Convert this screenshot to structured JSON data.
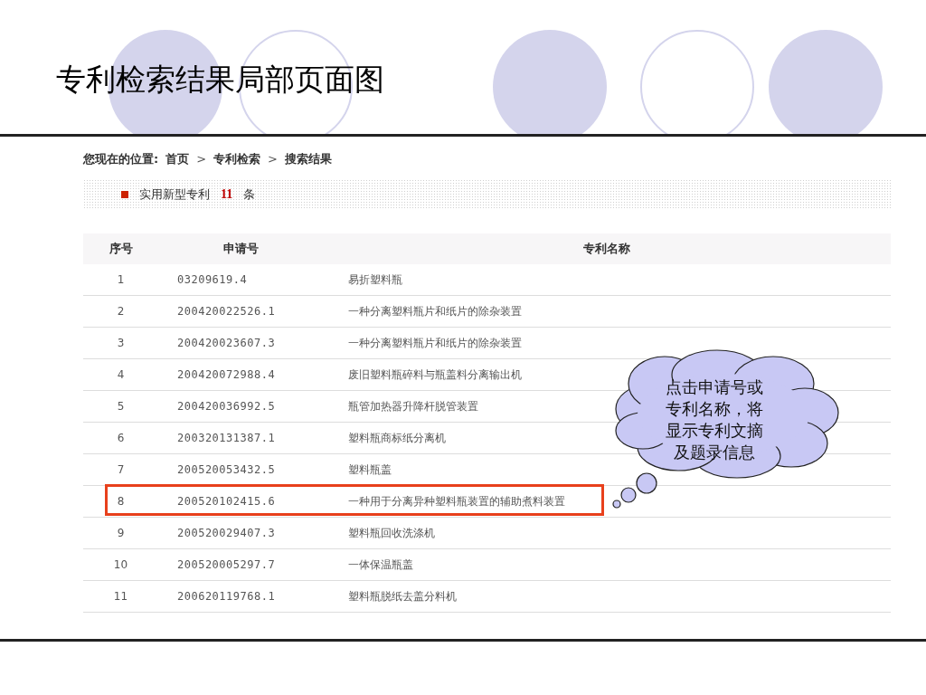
{
  "slide_title": "专利检索结果局部页面图",
  "breadcrumb": {
    "label": "您现在的位置:",
    "items": [
      "首页",
      "专利检索",
      "搜索结果"
    ],
    "separator": ">"
  },
  "section": {
    "label": "实用新型专利",
    "count": "11",
    "unit": "条"
  },
  "table": {
    "columns": [
      "序号",
      "申请号",
      "专利名称"
    ],
    "rows": [
      {
        "index": "1",
        "number": "03209619.4",
        "name": "易折塑料瓶",
        "highlighted": false
      },
      {
        "index": "2",
        "number": "200420022526.1",
        "name": "一种分离塑料瓶片和纸片的除杂装置",
        "highlighted": false
      },
      {
        "index": "3",
        "number": "200420023607.3",
        "name": "一种分离塑料瓶片和纸片的除杂装置",
        "highlighted": false
      },
      {
        "index": "4",
        "number": "200420072988.4",
        "name": "废旧塑料瓶碎料与瓶盖料分离输出机",
        "highlighted": false
      },
      {
        "index": "5",
        "number": "200420036992.5",
        "name": "瓶管加热器升降杆脱管装置",
        "highlighted": false
      },
      {
        "index": "6",
        "number": "200320131387.1",
        "name": "塑料瓶商标纸分离机",
        "highlighted": false
      },
      {
        "index": "7",
        "number": "200520053432.5",
        "name": "塑料瓶盖",
        "highlighted": false
      },
      {
        "index": "8",
        "number": "200520102415.6",
        "name": "一种用于分离异种塑料瓶装置的辅助煮料装置",
        "highlighted": true
      },
      {
        "index": "9",
        "number": "200520029407.3",
        "name": "塑料瓶回收洗涤机",
        "highlighted": false
      },
      {
        "index": "10",
        "number": "200520005297.7",
        "name": "一体保温瓶盖",
        "highlighted": false
      },
      {
        "index": "11",
        "number": "200620119768.1",
        "name": "塑料瓶脱纸去盖分料机",
        "highlighted": false
      }
    ]
  },
  "callout": {
    "lines": [
      "点击申请号或",
      "专利名称，将",
      "显示专利文摘",
      "及题录信息"
    ]
  }
}
